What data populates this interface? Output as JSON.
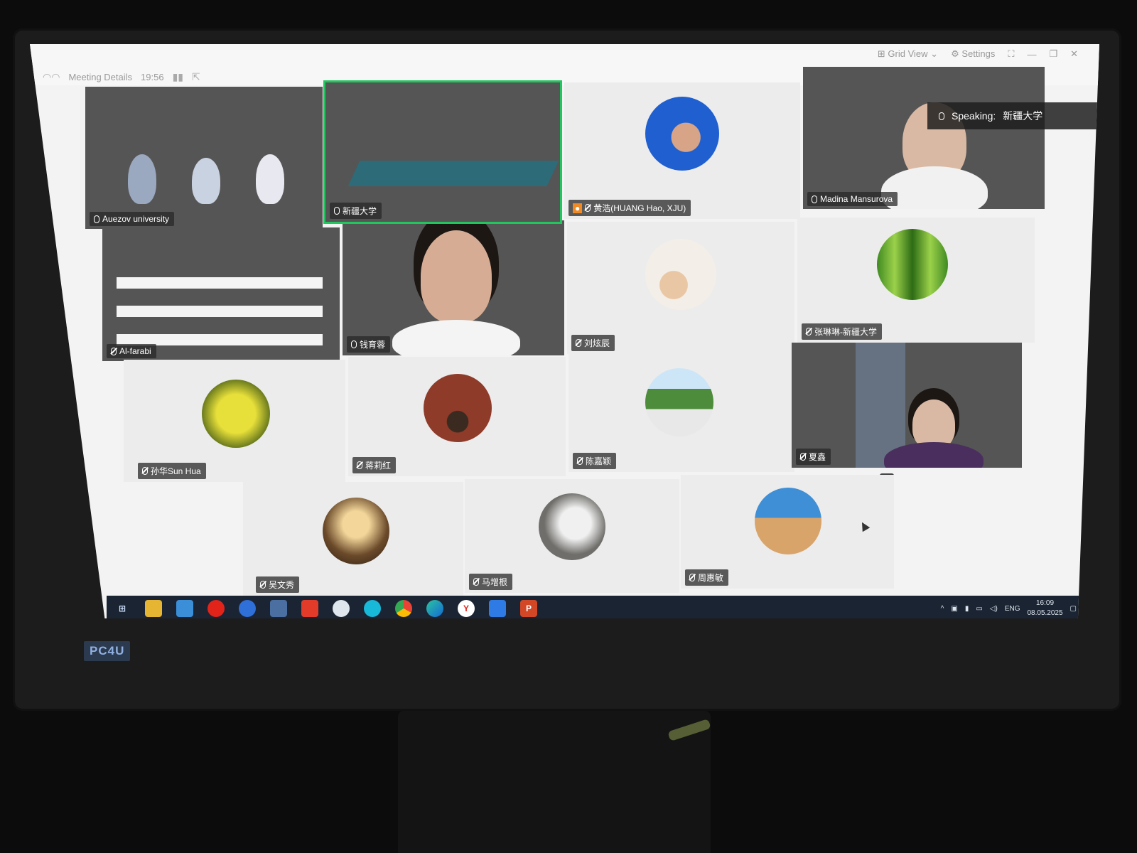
{
  "topbar": {
    "meeting_details": "Meeting Details",
    "timer": "19:56",
    "grid_view": "Grid View",
    "settings": "Settings"
  },
  "speaking": {
    "label": "Speaking:",
    "name": "新疆大学"
  },
  "participants": [
    {
      "name": "Auezov university"
    },
    {
      "name": "新疆大学"
    },
    {
      "name": "黄浩(HUANG Hao, XJU)"
    },
    {
      "name": "Madina Mansurova"
    },
    {
      "name": "Al-farabi"
    },
    {
      "name": "钱育蓉"
    },
    {
      "name": "刘炫辰"
    },
    {
      "name": "张琳琳-新疆大学"
    },
    {
      "name": "孙华Sun Hua"
    },
    {
      "name": "蒋莉红"
    },
    {
      "name": "陈嘉颖"
    },
    {
      "name": "夏鑫"
    },
    {
      "name": "吴文秀"
    },
    {
      "name": "马增根"
    },
    {
      "name": "周惠敏"
    }
  ],
  "taskbar": {
    "lang": "ENG",
    "time": "16:09",
    "date": "08.05.2025"
  },
  "monitor_brand": "PC4U",
  "colors": {
    "active_border": "#22c55e",
    "taskbar": "#1b2433"
  }
}
